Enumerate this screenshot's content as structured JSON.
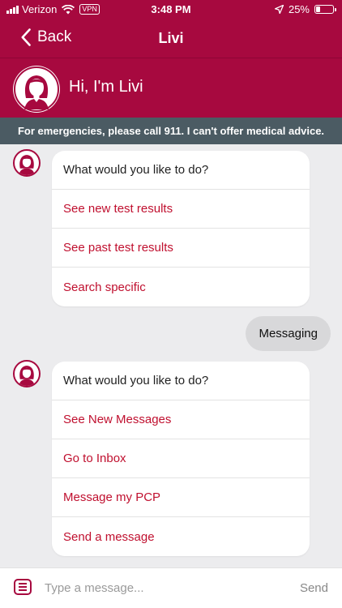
{
  "status_bar": {
    "carrier": "Verizon",
    "vpn": "VPN",
    "time": "3:48 PM",
    "battery": "25%",
    "battery_level": 0.25
  },
  "nav": {
    "back_label": "Back",
    "title": "Livi"
  },
  "hero": {
    "greeting": "Hi, I'm Livi"
  },
  "banner": {
    "text": "For emergencies, please call 911. I can't offer medical advice."
  },
  "messages": [
    {
      "prompt": "What would you like to do?",
      "options": [
        "See new test results",
        "See past test results",
        "Search specific"
      ]
    },
    {
      "user_text": "Messaging"
    },
    {
      "prompt": "What would you like to do?",
      "options": [
        "See New Messages",
        "Go to Inbox",
        "Message my PCP",
        "Send a message"
      ]
    }
  ],
  "composer": {
    "placeholder": "Type a message...",
    "send_label": "Send"
  },
  "colors": {
    "brand": "#a7093f",
    "banner": "#4b5b63",
    "option_text": "#c0102f",
    "background": "#ececee"
  }
}
